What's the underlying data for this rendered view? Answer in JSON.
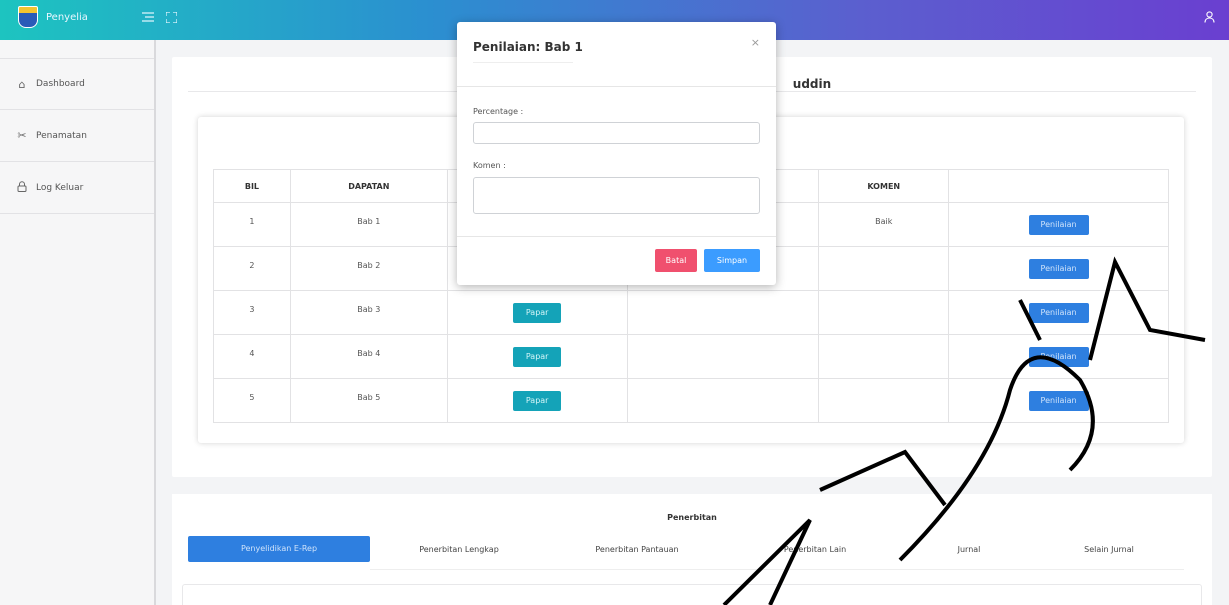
{
  "topbar": {
    "brand": "Penyelia",
    "menu_icon": "menu-toggle-icon",
    "fullscreen_icon": "fullscreen-icon",
    "user_icon": "user-icon"
  },
  "sidebar": {
    "items": [
      {
        "label": "Dashboard",
        "icon": "home-icon"
      },
      {
        "label": "Penamatan",
        "icon": "scissors-icon"
      },
      {
        "label": "Log Keluar",
        "icon": "lock-icon"
      }
    ]
  },
  "main": {
    "title_fragment": "uddin",
    "table": {
      "headers": [
        "BIL",
        "DAPATAN",
        "",
        "",
        "KOMEN",
        ""
      ],
      "rows": [
        {
          "bil": "1",
          "dapatan": "Bab 1",
          "komen": "Baik",
          "view": "",
          "action": "Penilaian"
        },
        {
          "bil": "2",
          "dapatan": "Bab 2",
          "komen": "",
          "view": "",
          "action": "Penilaian"
        },
        {
          "bil": "3",
          "dapatan": "Bab 3",
          "komen": "",
          "view": "Papar",
          "action": "Penilaian"
        },
        {
          "bil": "4",
          "dapatan": "Bab 4",
          "komen": "",
          "view": "Papar",
          "action": "Penilaian"
        },
        {
          "bil": "5",
          "dapatan": "Bab 5",
          "komen": "",
          "view": "Papar",
          "action": "Penilaian"
        }
      ]
    }
  },
  "penerbitan": {
    "title": "Penerbitan",
    "tabs": [
      "Penyelidikan E-Rep",
      "Penerbitan Lengkap",
      "Penerbitan Pantauan",
      "Penerbitan Lain",
      "Jurnal",
      "Selain Jurnal"
    ]
  },
  "modal": {
    "title": "Penilaian: Bab 1",
    "close": "×",
    "percentage_label": "Percentage :",
    "percentage_value": "",
    "comment_label": "Komen :",
    "comment_value": "",
    "cancel": "Batal",
    "save": "Simpan"
  },
  "colors": {
    "papar": "#14a3b8",
    "penilaian": "#2e7fe0",
    "batal": "#f0506e",
    "simpan": "#3b9cff"
  }
}
